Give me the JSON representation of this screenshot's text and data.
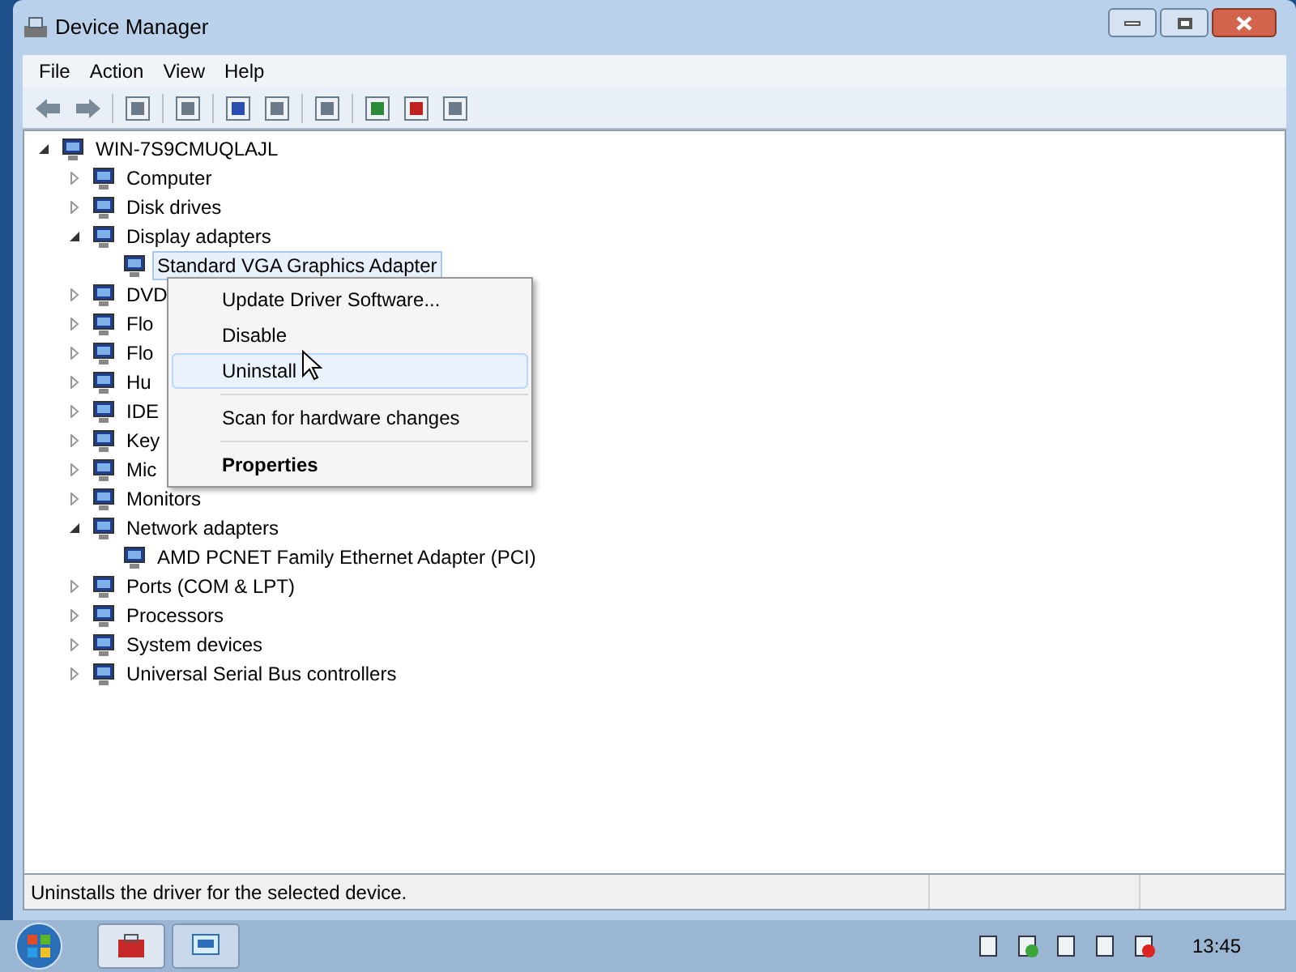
{
  "window": {
    "title": "Device Manager"
  },
  "menu_bar": [
    "File",
    "Action",
    "View",
    "Help"
  ],
  "tree": {
    "label": "WIN-7S9CMUQLAJL",
    "expanded": true,
    "children": [
      {
        "label": "Computer",
        "expanded": false
      },
      {
        "label": "Disk drives",
        "expanded": false
      },
      {
        "label": "Display adapters",
        "expanded": true,
        "children": [
          {
            "label": "Standard VGA Graphics Adapter",
            "selected": true
          }
        ]
      },
      {
        "label": "DVD",
        "expanded": false
      },
      {
        "label": "Flo",
        "expanded": false
      },
      {
        "label": "Flo",
        "expanded": false
      },
      {
        "label": "Hu",
        "expanded": false
      },
      {
        "label": "IDE",
        "expanded": false
      },
      {
        "label": "Key",
        "expanded": false
      },
      {
        "label": "Mic",
        "expanded": false
      },
      {
        "label": "Monitors",
        "expanded": false
      },
      {
        "label": "Network adapters",
        "expanded": true,
        "children": [
          {
            "label": "AMD PCNET Family Ethernet Adapter (PCI)",
            "selected": false
          }
        ]
      },
      {
        "label": "Ports (COM & LPT)",
        "expanded": false
      },
      {
        "label": "Processors",
        "expanded": false
      },
      {
        "label": "System devices",
        "expanded": false
      },
      {
        "label": "Universal Serial Bus controllers",
        "expanded": false
      }
    ]
  },
  "context_menu": [
    {
      "kind": "item",
      "label": "Update Driver Software...",
      "selected": false,
      "bold": false
    },
    {
      "kind": "item",
      "label": "Disable",
      "selected": false,
      "bold": false
    },
    {
      "kind": "item",
      "label": "Uninstall",
      "selected": true,
      "bold": false
    },
    {
      "kind": "separator"
    },
    {
      "kind": "item",
      "label": "Scan for hardware changes",
      "selected": false,
      "bold": false
    },
    {
      "kind": "separator"
    },
    {
      "kind": "item",
      "label": "Properties",
      "selected": false,
      "bold": true
    }
  ],
  "status_bar": "Uninstalls the driver for the selected device.",
  "taskbar": {
    "clock": "13:45"
  }
}
